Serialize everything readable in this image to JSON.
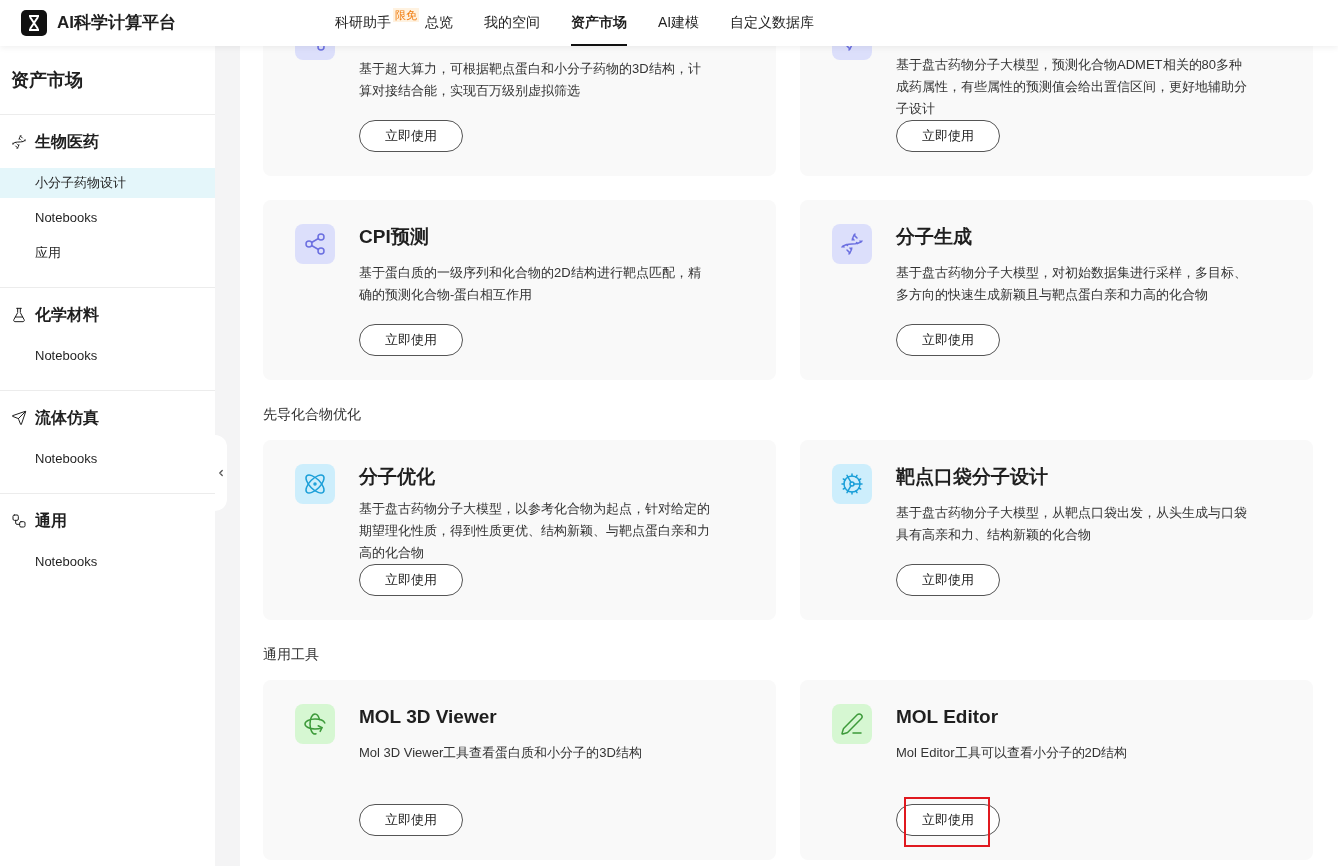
{
  "header": {
    "logo": "AI科学计算平台",
    "nav": [
      {
        "label": "科研助手",
        "badge": "限免",
        "selected": false
      },
      {
        "label": "总览",
        "selected": false
      },
      {
        "label": "我的空间",
        "selected": false
      },
      {
        "label": "资产市场",
        "selected": true
      },
      {
        "label": "AI建模",
        "selected": false
      },
      {
        "label": "自定义数据库",
        "selected": false
      }
    ]
  },
  "sidebar": {
    "title": "资产市场",
    "groups": [
      {
        "label": "生物医药",
        "items": [
          {
            "label": "小分子药物设计",
            "selected": true
          },
          {
            "label": "Notebooks",
            "selected": false
          },
          {
            "label": "应用",
            "selected": false
          }
        ]
      },
      {
        "label": "化学材料",
        "items": [
          {
            "label": "Notebooks",
            "selected": false
          }
        ]
      },
      {
        "label": "流体仿真",
        "items": [
          {
            "label": "Notebooks",
            "selected": false
          }
        ]
      },
      {
        "label": "通用",
        "items": [
          {
            "label": "Notebooks",
            "selected": false
          }
        ]
      }
    ]
  },
  "sections": [
    {
      "cards": [
        {
          "description": "基于超大算力，可根据靶点蛋白和小分子药物的3D结构，计算对接结合能，实现百万级别虚拟筛选",
          "button": {
            "label": "立即使用",
            "highlighted": false
          }
        },
        {
          "description": "基于盘古药物分子大模型，预测化合物ADMET相关的80多种成药属性，有些属性的预测值会给出置信区间，更好地辅助分子设计",
          "button": {
            "label": "立即使用",
            "highlighted": false
          }
        },
        {
          "title": "CPI预测",
          "description": "基于蛋白质的一级序列和化合物的2D结构进行靶点匹配，精确的预测化合物-蛋白相互作用",
          "button": {
            "label": "立即使用",
            "highlighted": false
          }
        },
        {
          "title": "分子生成",
          "description": "基于盘古药物分子大模型，对初始数据集进行采样，多目标、多方向的快速生成新颖且与靶点蛋白亲和力高的化合物",
          "button": {
            "label": "立即使用",
            "highlighted": false
          }
        }
      ]
    },
    {
      "heading": "先导化合物优化",
      "cards": [
        {
          "title": "分子优化",
          "description": "基于盘古药物分子大模型，以参考化合物为起点，针对给定的期望理化性质，得到性质更优、结构新颖、与靶点蛋白亲和力高的化合物",
          "button": {
            "label": "立即使用",
            "highlighted": false
          }
        },
        {
          "title": "靶点口袋分子设计",
          "description": "基于盘古药物分子大模型，从靶点口袋出发，从头生成与口袋具有高亲和力、结构新颖的化合物",
          "button": {
            "label": "立即使用",
            "highlighted": false
          }
        }
      ]
    },
    {
      "heading": "通用工具",
      "cards": [
        {
          "title": "MOL 3D Viewer",
          "description": "Mol 3D Viewer工具查看蛋白质和小分子的3D结构",
          "button": {
            "label": "立即使用",
            "highlighted": false
          }
        },
        {
          "title": "MOL Editor",
          "description": "Mol Editor工具可以查看小分子的2D结构",
          "button": {
            "label": "立即使用",
            "highlighted": true
          }
        }
      ]
    }
  ]
}
